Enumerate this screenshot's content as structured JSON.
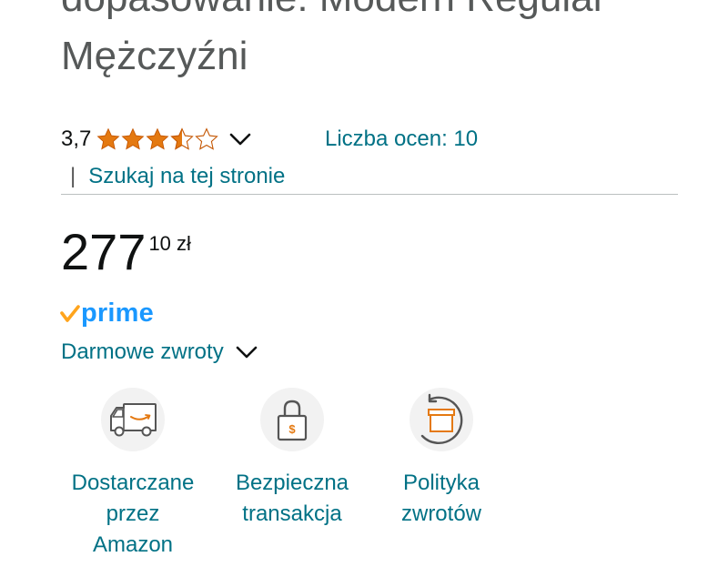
{
  "product": {
    "title_lines": [
      "dopasowanie: Modern Regular",
      "Mężczyźni"
    ]
  },
  "rating": {
    "value": "3,7",
    "stars": 3.7,
    "stars_max": 5,
    "ratings_count_label": "Liczba ocen: 10"
  },
  "search": {
    "separator": "|",
    "link_label": "Szukaj na tej stronie"
  },
  "price": {
    "whole": "277",
    "fraction": "10 zł"
  },
  "prime": {
    "label": "prime"
  },
  "returns": {
    "label": "Darmowe zwroty"
  },
  "features": [
    {
      "icon": "delivery-truck-icon",
      "label_lines": [
        "Dostarczane",
        "przez",
        "Amazon"
      ]
    },
    {
      "icon": "secure-lock-icon",
      "label_lines": [
        "Bezpieczna",
        "transakcja"
      ]
    },
    {
      "icon": "return-box-icon",
      "label_lines": [
        "Polityka",
        "zwrotów"
      ]
    }
  ],
  "colors": {
    "link": "#007185",
    "star": "#e47911",
    "prime_blue": "#1a98ff",
    "prime_check": "#ffa41c",
    "title_gray": "#565959",
    "icon_circle": "#f2f2f2"
  }
}
